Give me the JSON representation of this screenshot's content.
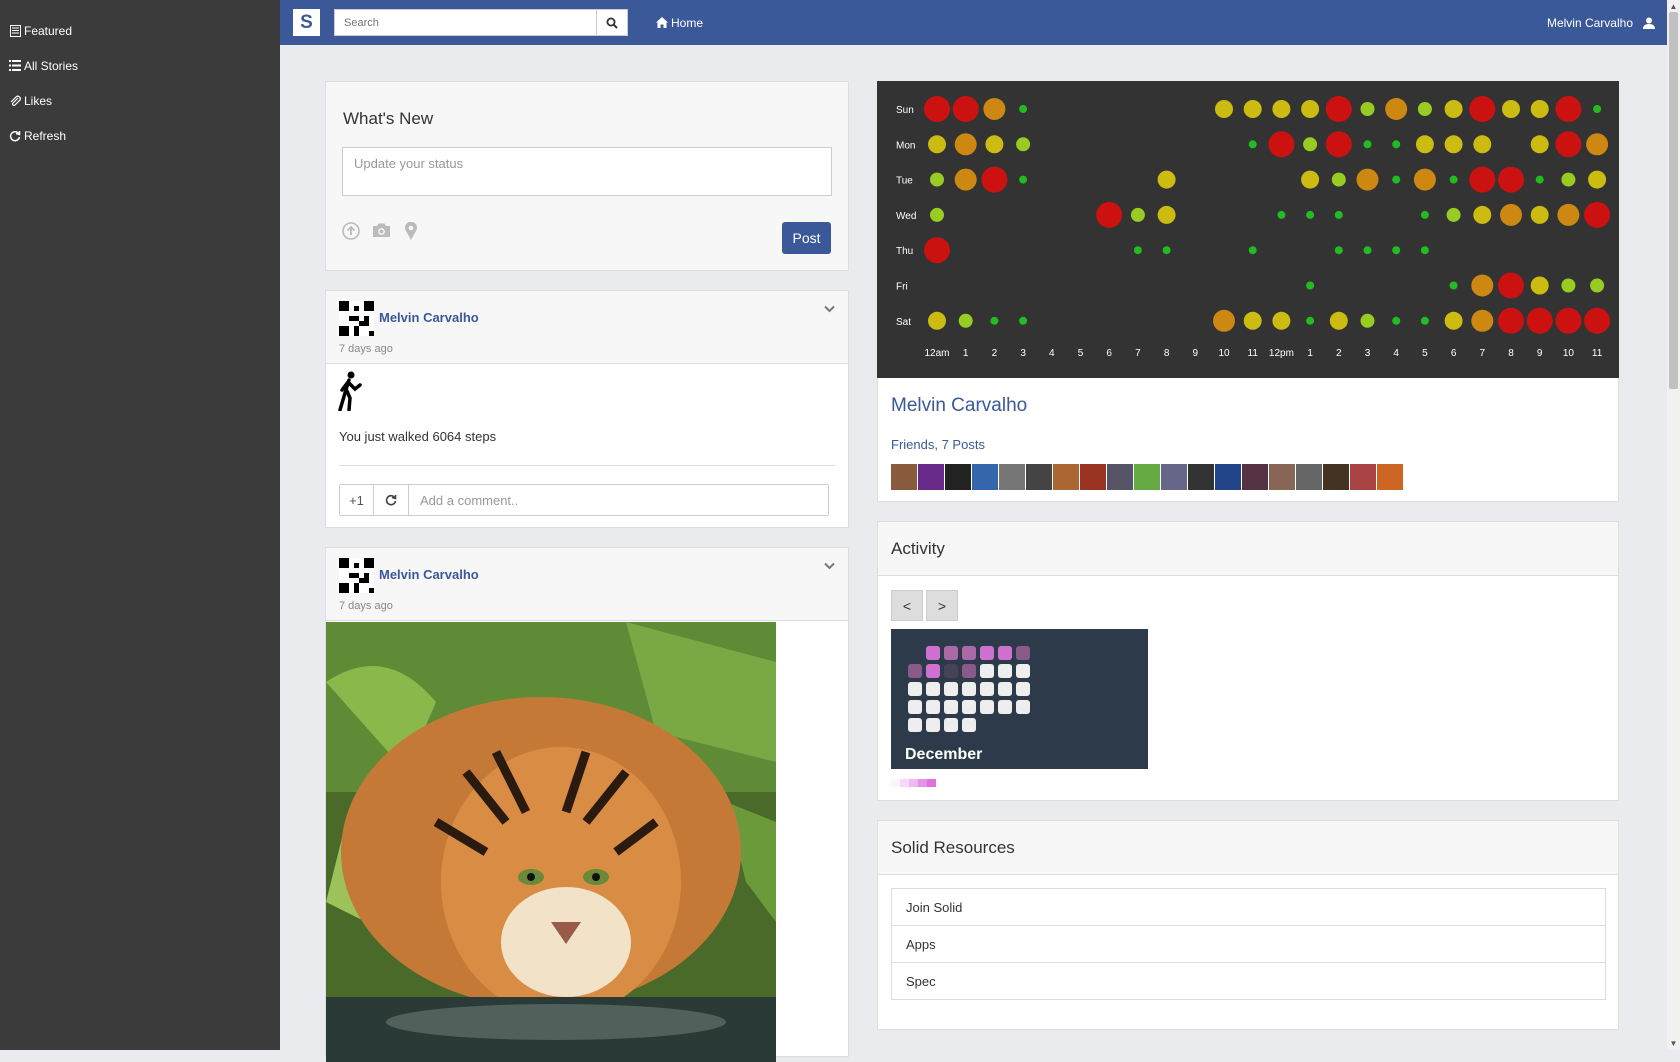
{
  "sidebar": {
    "items": [
      {
        "label": "Featured",
        "icon": "document-icon"
      },
      {
        "label": "All Stories",
        "icon": "list-icon"
      },
      {
        "label": "Likes",
        "icon": "paperclip-icon"
      },
      {
        "label": "Refresh",
        "icon": "refresh-icon"
      }
    ]
  },
  "topbar": {
    "logo": "S",
    "search_placeholder": "Search",
    "home_label": "Home",
    "user_name": "Melvin Carvalho"
  },
  "whats_new": {
    "title": "What's New",
    "status_placeholder": "Update your status",
    "post_label": "Post"
  },
  "posts": [
    {
      "author": "Melvin Carvalho",
      "time": "7 days ago",
      "text": "You just walked 6064 steps",
      "plus_label": "+1",
      "comment_placeholder": "Add a comment.."
    },
    {
      "author": "Melvin Carvalho",
      "time": "7 days ago"
    }
  ],
  "heatmap": {
    "days": [
      "Sun",
      "Mon",
      "Tue",
      "Wed",
      "Thu",
      "Fri",
      "Sat"
    ],
    "hours": [
      "12am",
      "1",
      "2",
      "3",
      "4",
      "5",
      "6",
      "7",
      "8",
      "9",
      "10",
      "11",
      "12pm",
      "1",
      "2",
      "3",
      "4",
      "5",
      "6",
      "7",
      "8",
      "9",
      "10",
      "11"
    ],
    "levels": [
      [
        5,
        5,
        4,
        1,
        0,
        0,
        0,
        0,
        0,
        0,
        3,
        3,
        3,
        3,
        5,
        2,
        4,
        2,
        3,
        5,
        3,
        3,
        5,
        1
      ],
      [
        3,
        4,
        3,
        2,
        0,
        0,
        0,
        0,
        0,
        0,
        0,
        1,
        5,
        2,
        5,
        1,
        1,
        3,
        3,
        3,
        0,
        3,
        5,
        4
      ],
      [
        2,
        4,
        5,
        1,
        0,
        0,
        0,
        0,
        3,
        0,
        0,
        0,
        0,
        3,
        2,
        4,
        1,
        4,
        1,
        5,
        5,
        1,
        2,
        3
      ],
      [
        2,
        0,
        0,
        0,
        0,
        0,
        5,
        2,
        3,
        0,
        0,
        0,
        1,
        1,
        1,
        0,
        0,
        1,
        2,
        3,
        4,
        3,
        4,
        5
      ],
      [
        5,
        0,
        0,
        0,
        0,
        0,
        0,
        1,
        1,
        0,
        0,
        1,
        0,
        0,
        1,
        1,
        1,
        1,
        0,
        0,
        0,
        0,
        0,
        0
      ],
      [
        0,
        0,
        0,
        0,
        0,
        0,
        0,
        0,
        0,
        0,
        0,
        0,
        0,
        1,
        0,
        0,
        0,
        0,
        1,
        4,
        5,
        3,
        2,
        2
      ],
      [
        3,
        2,
        1,
        1,
        0,
        0,
        0,
        0,
        0,
        0,
        4,
        3,
        3,
        1,
        3,
        2,
        1,
        1,
        3,
        4,
        5,
        5,
        5,
        5
      ]
    ],
    "colors": [
      "#333333",
      "#22bb22",
      "#99cc22",
      "#ccbb11",
      "#cc8811",
      "#cc1111"
    ]
  },
  "profile": {
    "name": "Melvin Carvalho",
    "friends_label": "Friends",
    "posts_label": "7 Posts",
    "friend_colors": [
      "#8a5a3c",
      "#6a2a8a",
      "#222222",
      "#3366aa",
      "#777777",
      "#444444",
      "#aa6633",
      "#993322",
      "#555566",
      "#66aa44",
      "#666688",
      "#333333",
      "#224488",
      "#553344",
      "#886655",
      "#666666",
      "#443322",
      "#aa4444",
      "#cc6622"
    ]
  },
  "activity": {
    "title": "Activity",
    "prev_label": "<",
    "next_label": ">",
    "month": "December",
    "grid": [
      [
        0,
        3,
        2,
        2,
        3,
        3,
        1
      ],
      [
        1,
        3,
        0,
        1,
        4,
        4,
        4
      ],
      [
        4,
        4,
        4,
        4,
        4,
        4,
        4
      ],
      [
        4,
        4,
        4,
        4,
        4,
        4,
        4
      ],
      [
        4,
        4,
        4,
        4,
        -1,
        -1,
        -1
      ]
    ],
    "grid_start": 1,
    "grid_colors": [
      "#444455",
      "#8a5a8a",
      "#aa6aaa",
      "#d070d0",
      "#eeeeee"
    ],
    "legend_colors": [
      "#fdf2fd",
      "#f8d8f8",
      "#f0b8f0",
      "#e890e8",
      "#e070e0"
    ]
  },
  "resources": {
    "title": "Solid Resources",
    "items": [
      "Join Solid",
      "Apps",
      "Spec"
    ]
  }
}
